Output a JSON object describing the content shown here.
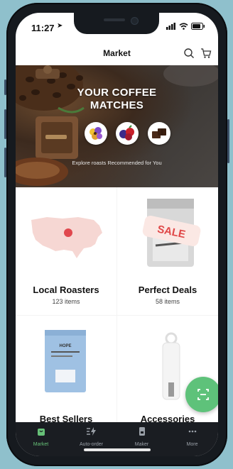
{
  "status": {
    "time": "11:27"
  },
  "header": {
    "title": "Market"
  },
  "hero": {
    "title_line1": "YOUR COFFEE",
    "title_line2": "MATCHES",
    "subtitle": "Explore roasts Recommended for You"
  },
  "categories": [
    {
      "title": "Local Roasters",
      "count": "123 items"
    },
    {
      "title": "Perfect Deals",
      "count": "58 items",
      "badge": "SALE"
    },
    {
      "title": "Best Sellers",
      "count": ""
    },
    {
      "title": "Accessories",
      "count": ""
    }
  ],
  "product_label": "HOPE",
  "tabs": [
    {
      "label": "Market",
      "icon": "bag-icon",
      "active": true
    },
    {
      "label": "Auto-order",
      "icon": "lightning-icon",
      "active": false
    },
    {
      "label": "Maker",
      "icon": "machine-icon",
      "active": false
    },
    {
      "label": "More",
      "icon": "more-dots-icon",
      "active": false
    }
  ],
  "colors": {
    "accent": "#5ec27a",
    "tabbar": "#1a1d22",
    "background": "#8fc0cc",
    "sale": "#e04848"
  }
}
